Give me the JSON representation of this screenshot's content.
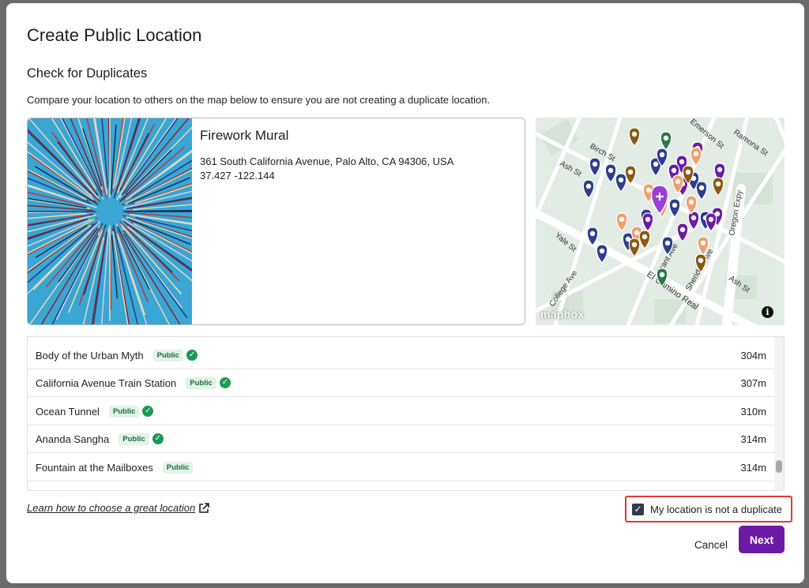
{
  "modal": {
    "title": "Create Public Location",
    "subtitle": "Check for Duplicates",
    "description": "Compare your location to others on the map below to ensure you are not creating a duplicate location."
  },
  "location_card": {
    "name": "Firework Mural",
    "address": "361 South California Avenue, Palo Alto, CA 94306, USA",
    "coordinates": "37.427 -122.144"
  },
  "map": {
    "logo": "mapbox",
    "info_label": "i",
    "street_labels": [
      "Ramona St",
      "Emerson St",
      "Birch St",
      "Ash St",
      "Oregon Expy",
      "Yale St",
      "Grant Ave",
      "Sheridan Ave",
      "College Ave",
      "El Camino Real",
      "Ash St"
    ]
  },
  "nearby_locations": [
    {
      "name": "Body of the Urban Myth",
      "badge": "Public",
      "verified": true,
      "distance": "304m"
    },
    {
      "name": "California Avenue Train Station",
      "badge": "Public",
      "verified": true,
      "distance": "307m"
    },
    {
      "name": "Ocean Tunnel",
      "badge": "Public",
      "verified": true,
      "distance": "310m"
    },
    {
      "name": "Ananda Sangha",
      "badge": "Public",
      "verified": true,
      "distance": "314m"
    },
    {
      "name": "Fountain at the Mailboxes",
      "badge": "Public",
      "verified": false,
      "distance": "314m"
    }
  ],
  "footer": {
    "learn_link": "Learn how to choose a great location",
    "not_duplicate_label": "My location is not a duplicate",
    "not_duplicate_checked": true,
    "cancel_label": "Cancel",
    "next_label": "Next"
  },
  "colors": {
    "primary": "#6b1aa6",
    "badge_bg": "#e2f3e8",
    "verified": "#1c9a55",
    "highlight": "#e53935"
  }
}
